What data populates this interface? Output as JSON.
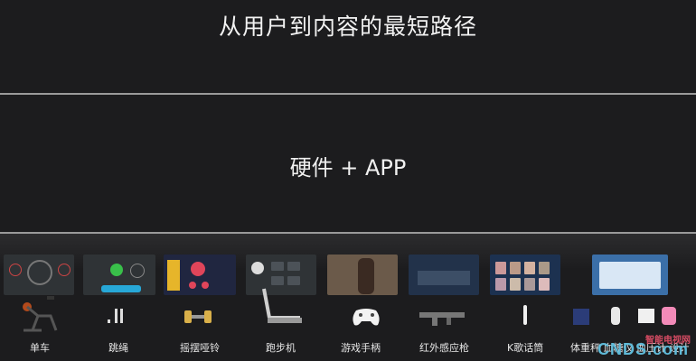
{
  "slide": {
    "title": "从用户到内容的最短路径",
    "subtitle": "硬件 + APP"
  },
  "products": [
    {
      "label": "单车",
      "icon": "exercise-bike-icon"
    },
    {
      "label": "跳绳",
      "icon": "jump-rope-icon"
    },
    {
      "label": "摇摆哑铃",
      "icon": "dumbbell-icon"
    },
    {
      "label": "跑步机",
      "icon": "treadmill-icon"
    },
    {
      "label": "游戏手柄",
      "icon": "gamepad-icon"
    },
    {
      "label": "红外感应枪",
      "icon": "infrared-gun-icon"
    },
    {
      "label": "K歌话筒",
      "icon": "microphone-icon"
    },
    {
      "label": "体重秤 血糖仪 血压计 设计",
      "icon": "health-devices-icon"
    }
  ],
  "watermark": {
    "top": "智能电视网",
    "main": "CNDS.com"
  },
  "colors": {
    "background": "#1c1c1e",
    "divider": "#9a9a9a",
    "watermark_red": "#d84c64",
    "watermark_blue": "#5fbad8"
  }
}
